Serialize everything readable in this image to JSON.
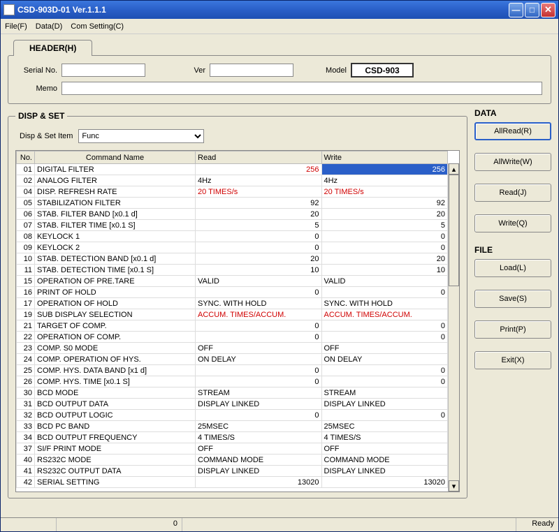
{
  "title": "CSD-903D-01 Ver.1.1.1",
  "menu": {
    "file": "File(F)",
    "data": "Data(D)",
    "com": "Com Setting(C)"
  },
  "header": {
    "tab": "HEADER(H)",
    "serial_lbl": "Serial No.",
    "serial_val": "",
    "ver_lbl": "Ver",
    "ver_val": "",
    "model_lbl": "Model",
    "model_val": "CSD-903",
    "memo_lbl": "Memo",
    "memo_val": ""
  },
  "dispset": {
    "legend": "DISP & SET",
    "item_lbl": "Disp & Set Item",
    "item_val": "Func"
  },
  "columns": {
    "no": "No.",
    "name": "Command Name",
    "read": "Read",
    "write": "Write"
  },
  "rows": [
    {
      "no": "01",
      "name": "DIGITAL FILTER",
      "read": "256",
      "write": "256",
      "numeric": true,
      "selected": true,
      "red": true
    },
    {
      "no": "02",
      "name": "ANALOG FILTER",
      "read": "4Hz",
      "write": "4Hz"
    },
    {
      "no": "04",
      "name": "DISP. REFRESH RATE",
      "read": "20 TIMES/s",
      "write": "20 TIMES/s",
      "red": true
    },
    {
      "no": "05",
      "name": "STABILIZATION FILTER",
      "read": "92",
      "write": "92",
      "numeric": true
    },
    {
      "no": "06",
      "name": "STAB. FILTER BAND [x0.1 d]",
      "read": "20",
      "write": "20",
      "numeric": true
    },
    {
      "no": "07",
      "name": "STAB. FILTER TIME [x0.1 S]",
      "read": "5",
      "write": "5",
      "numeric": true
    },
    {
      "no": "08",
      "name": "KEYLOCK 1",
      "read": "0",
      "write": "0",
      "numeric": true
    },
    {
      "no": "09",
      "name": "KEYLOCK 2",
      "read": "0",
      "write": "0",
      "numeric": true
    },
    {
      "no": "10",
      "name": "STAB. DETECTION BAND [x0.1 d]",
      "read": "20",
      "write": "20",
      "numeric": true
    },
    {
      "no": "11",
      "name": "STAB. DETECTION TIME [x0.1 S]",
      "read": "10",
      "write": "10",
      "numeric": true
    },
    {
      "no": "15",
      "name": "OPERATION OF PRE.TARE",
      "read": "VALID",
      "write": "VALID"
    },
    {
      "no": "16",
      "name": "PRINT OF HOLD",
      "read": "0",
      "write": "0",
      "numeric": true
    },
    {
      "no": "17",
      "name": "OPERATION OF HOLD",
      "read": "SYNC. WITH HOLD",
      "write": "SYNC. WITH HOLD"
    },
    {
      "no": "19",
      "name": "SUB DISPLAY SELECTION",
      "read": "ACCUM. TIMES/ACCUM.",
      "write": "ACCUM. TIMES/ACCUM.",
      "red": true
    },
    {
      "no": "21",
      "name": "TARGET OF COMP.",
      "read": "0",
      "write": "0",
      "numeric": true
    },
    {
      "no": "22",
      "name": "OPERATION OF COMP.",
      "read": "0",
      "write": "0",
      "numeric": true
    },
    {
      "no": "23",
      "name": "COMP. S0 MODE",
      "read": "OFF",
      "write": "OFF"
    },
    {
      "no": "24",
      "name": "COMP. OPERATION OF HYS.",
      "read": "ON DELAY",
      "write": "ON DELAY"
    },
    {
      "no": "25",
      "name": "COMP. HYS. DATA BAND [x1 d]",
      "read": "0",
      "write": "0",
      "numeric": true
    },
    {
      "no": "26",
      "name": "COMP. HYS. TIME [x0.1 S]",
      "read": "0",
      "write": "0",
      "numeric": true
    },
    {
      "no": "30",
      "name": "BCD MODE",
      "read": "STREAM",
      "write": "STREAM"
    },
    {
      "no": "31",
      "name": "BCD OUTPUT DATA",
      "read": "DISPLAY LINKED",
      "write": "DISPLAY LINKED"
    },
    {
      "no": "32",
      "name": "BCD OUTPUT LOGIC",
      "read": "0",
      "write": "0",
      "numeric": true
    },
    {
      "no": "33",
      "name": "BCD PC BAND",
      "read": "25MSEC",
      "write": "25MSEC"
    },
    {
      "no": "34",
      "name": "BCD OUTPUT FREQUENCY",
      "read": "4 TIMES/S",
      "write": "4 TIMES/S"
    },
    {
      "no": "37",
      "name": "SI/F PRINT MODE",
      "read": "OFF",
      "write": "OFF"
    },
    {
      "no": "40",
      "name": "RS232C MODE",
      "read": "COMMAND MODE",
      "write": "COMMAND MODE"
    },
    {
      "no": "41",
      "name": "RS232C OUTPUT DATA",
      "read": "DISPLAY LINKED",
      "write": "DISPLAY LINKED"
    },
    {
      "no": "42",
      "name": "SERIAL SETTING",
      "read": "13020",
      "write": "13020",
      "numeric": true
    }
  ],
  "side": {
    "data_lbl": "DATA",
    "allread": "AllRead(R)",
    "allwrite": "AllWrite(W)",
    "read": "Read(J)",
    "write": "Write(Q)",
    "file_lbl": "FILE",
    "load": "Load(L)",
    "save": "Save(S)",
    "print": "Print(P)",
    "exit": "Exit(X)"
  },
  "status": {
    "mid": "0",
    "ready": "Ready"
  }
}
